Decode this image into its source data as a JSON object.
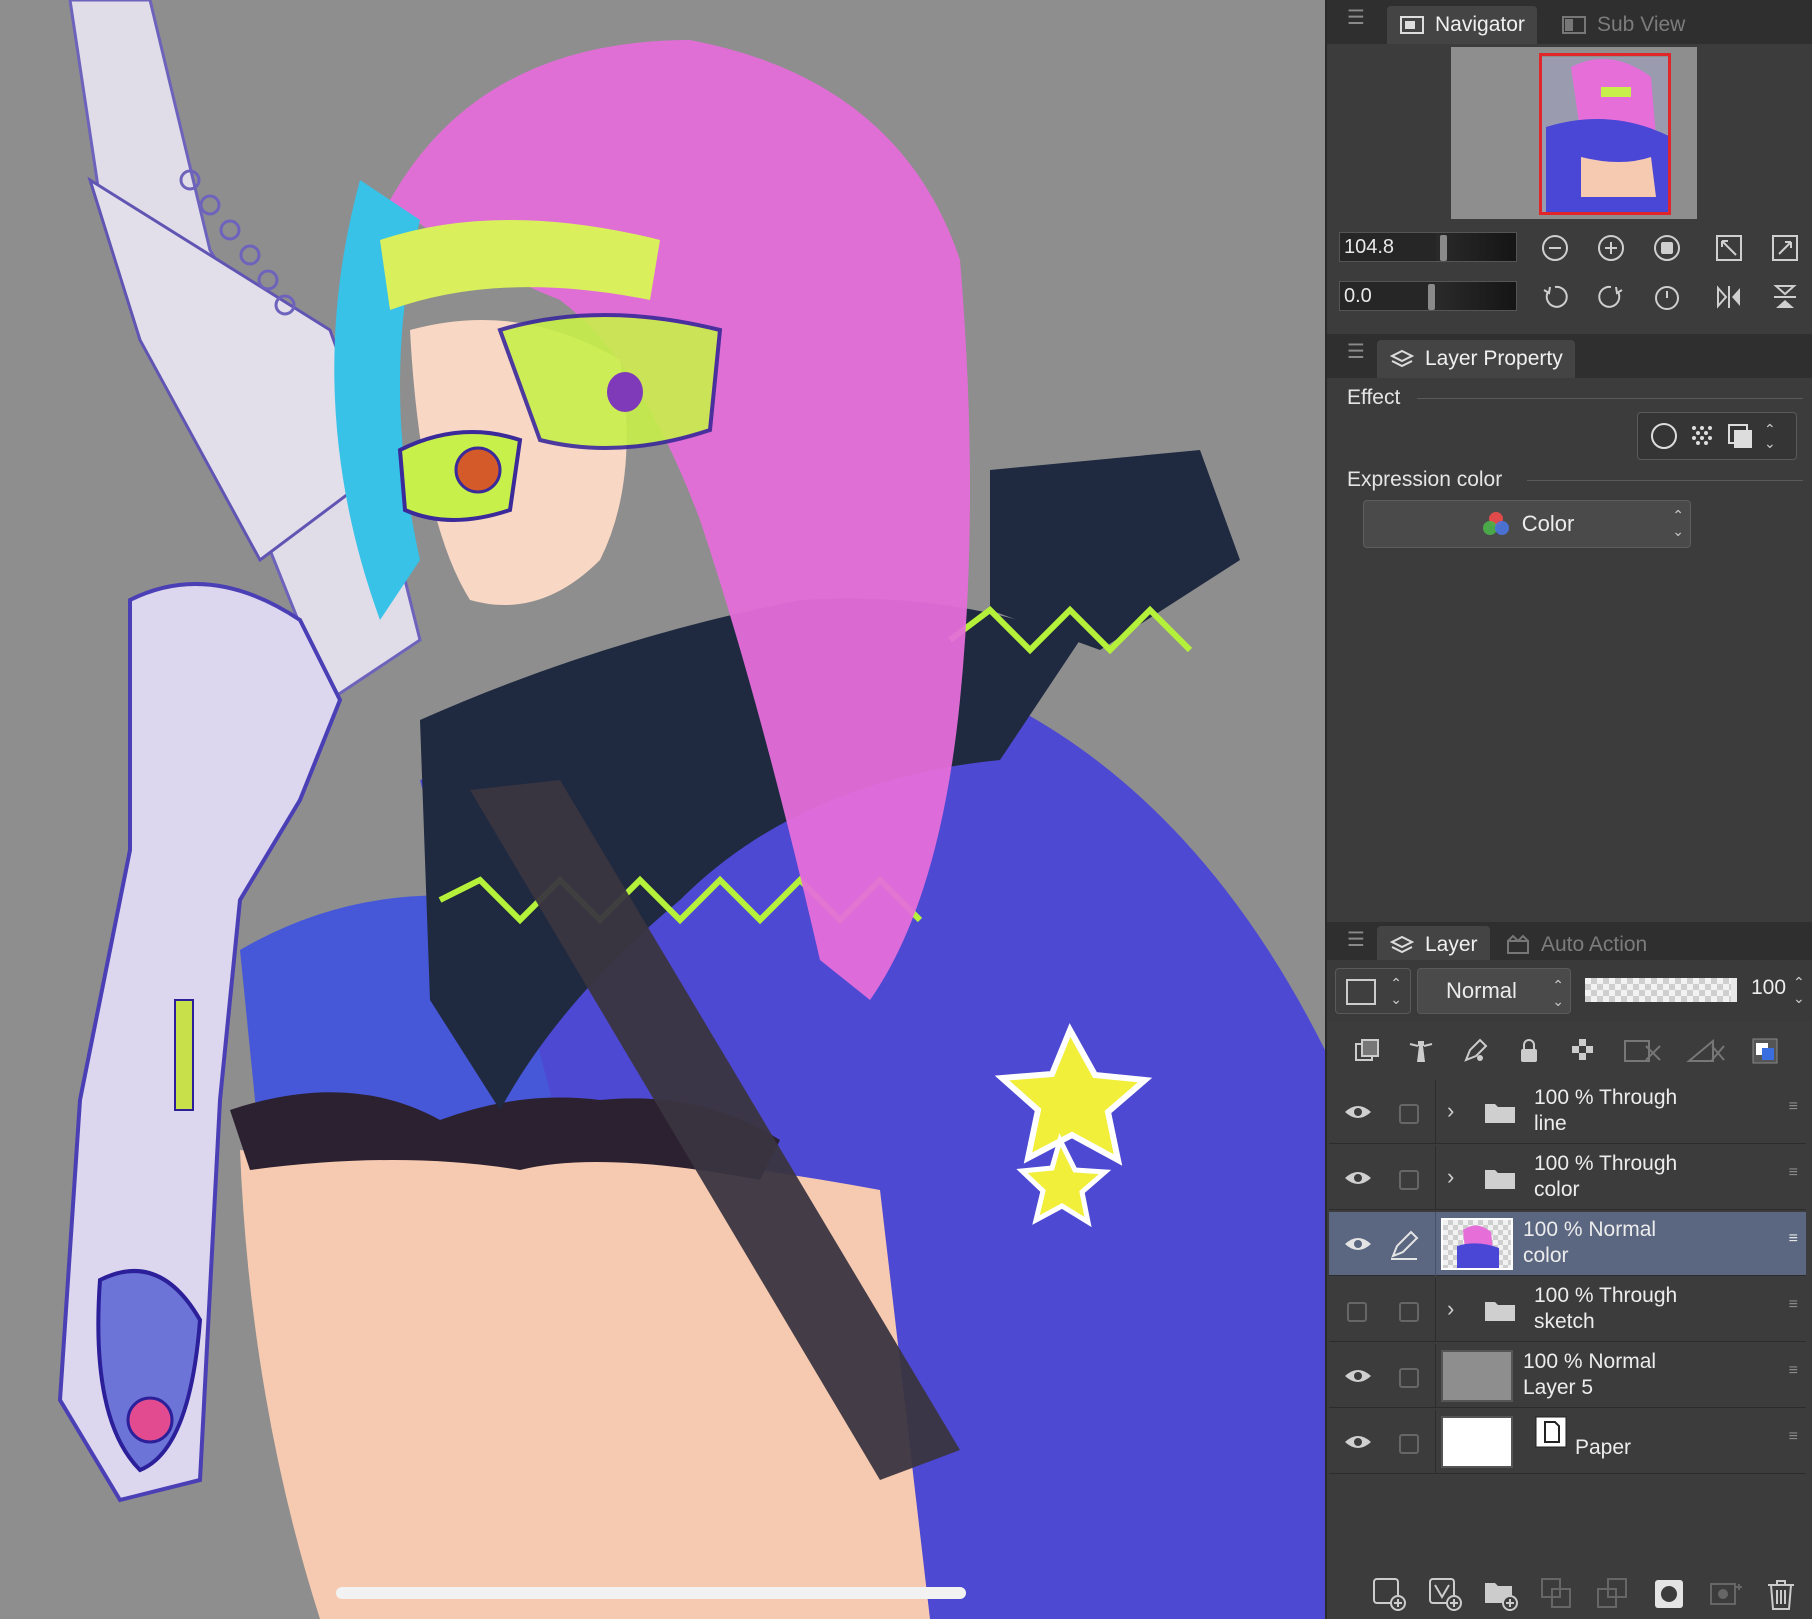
{
  "navigator": {
    "tab_navigator": "Navigator",
    "tab_subview": "Sub View",
    "zoom_value": "104.8",
    "rotation_value": "0.0"
  },
  "layer_property": {
    "tab_label": "Layer Property",
    "effect_label": "Effect",
    "expression_color_label": "Expression color",
    "expression_color_value": "Color"
  },
  "layer_panel": {
    "tab_layer": "Layer",
    "tab_auto_action": "Auto Action",
    "blend_mode": "Normal",
    "opacity": "100",
    "layers": [
      {
        "opacity_mode": "100 %  Through",
        "name": "line",
        "type": "folder",
        "visible": true,
        "selected": false
      },
      {
        "opacity_mode": "100 %  Through",
        "name": "color",
        "type": "folder",
        "visible": true,
        "selected": false
      },
      {
        "opacity_mode": "100 %  Normal",
        "name": "color",
        "type": "raster",
        "visible": true,
        "selected": true
      },
      {
        "opacity_mode": "100 %  Through",
        "name": "sketch",
        "type": "folder",
        "visible": false,
        "selected": false
      },
      {
        "opacity_mode": "100 %  Normal",
        "name": "Layer 5",
        "type": "fill-gray",
        "visible": true,
        "selected": false
      },
      {
        "opacity_mode": "",
        "name": "Paper",
        "type": "paper",
        "visible": true,
        "selected": false
      }
    ]
  },
  "colors": {
    "canvas_bg": "#8e8e8e",
    "panel_bg": "#3c3c3c",
    "selected_row": "#5b6680",
    "nav_frame": "#e0262a"
  }
}
